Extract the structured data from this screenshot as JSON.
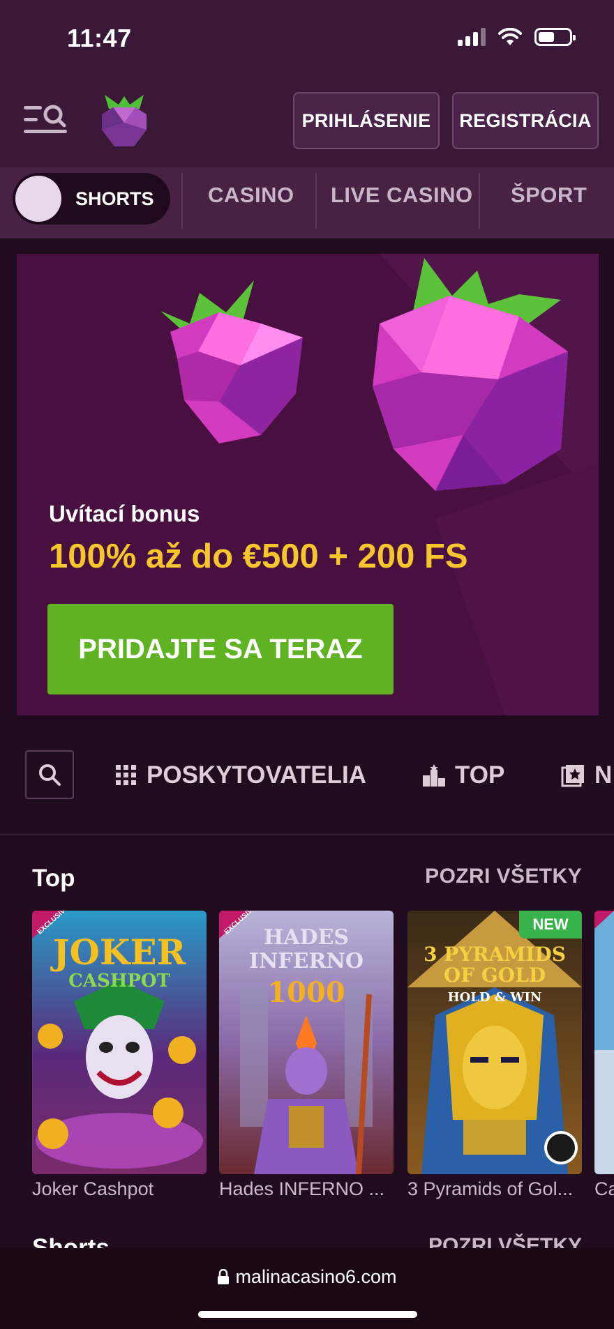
{
  "status_bar": {
    "time": "11:47"
  },
  "header": {
    "login_label": "PRIHLÁSENIE",
    "register_label": "REGISTRÁCIA"
  },
  "tabs": {
    "toggle_label": "SHORTS",
    "items": [
      "CASINO",
      "LIVE CASINO",
      "ŠPORT"
    ]
  },
  "banner": {
    "bonus_label": "Uvítací bonus",
    "bonus_amount": "100% až do €500 + 200 FS",
    "cta_label": "PRIDAJTE SA TERAZ"
  },
  "filters": {
    "items": [
      {
        "label": "POSKYTOVATELIA",
        "icon": "grid-icon"
      },
      {
        "label": "TOP",
        "icon": "podium-icon"
      },
      {
        "label": "N",
        "icon": "star-box-icon"
      }
    ]
  },
  "top_section": {
    "title": "Top",
    "see_all": "POZRI VŠETKY",
    "games": [
      {
        "name": "Joker Cashpot",
        "badge": "EXCLUSIVE",
        "art_title": "JOKER",
        "art_sub": "CASHPOT"
      },
      {
        "name": "Hades INFERNO ...",
        "badge": "EXCLUSIVE",
        "art_title": "HADES INFERNO",
        "art_sub": "1000"
      },
      {
        "name": "3 Pyramids of Gol...",
        "badge": "NEW",
        "art_title": "3 PYRAMIDS OF GOLD",
        "art_sub": "HOLD & WIN"
      },
      {
        "name": "Ca",
        "badge": "EXCLUSIVE"
      }
    ]
  },
  "next_section": {
    "title": "Shorts",
    "see_all": "POZRI VŠETKY"
  },
  "url_bar": {
    "url": "malinacasino6.com"
  },
  "colors": {
    "header_bg": "#3a1838",
    "tab_bg": "#472245",
    "banner_bg": "#47103f",
    "accent_yellow": "#f7c52c",
    "cta_green": "#5fb322",
    "new_badge": "#38b24a"
  }
}
